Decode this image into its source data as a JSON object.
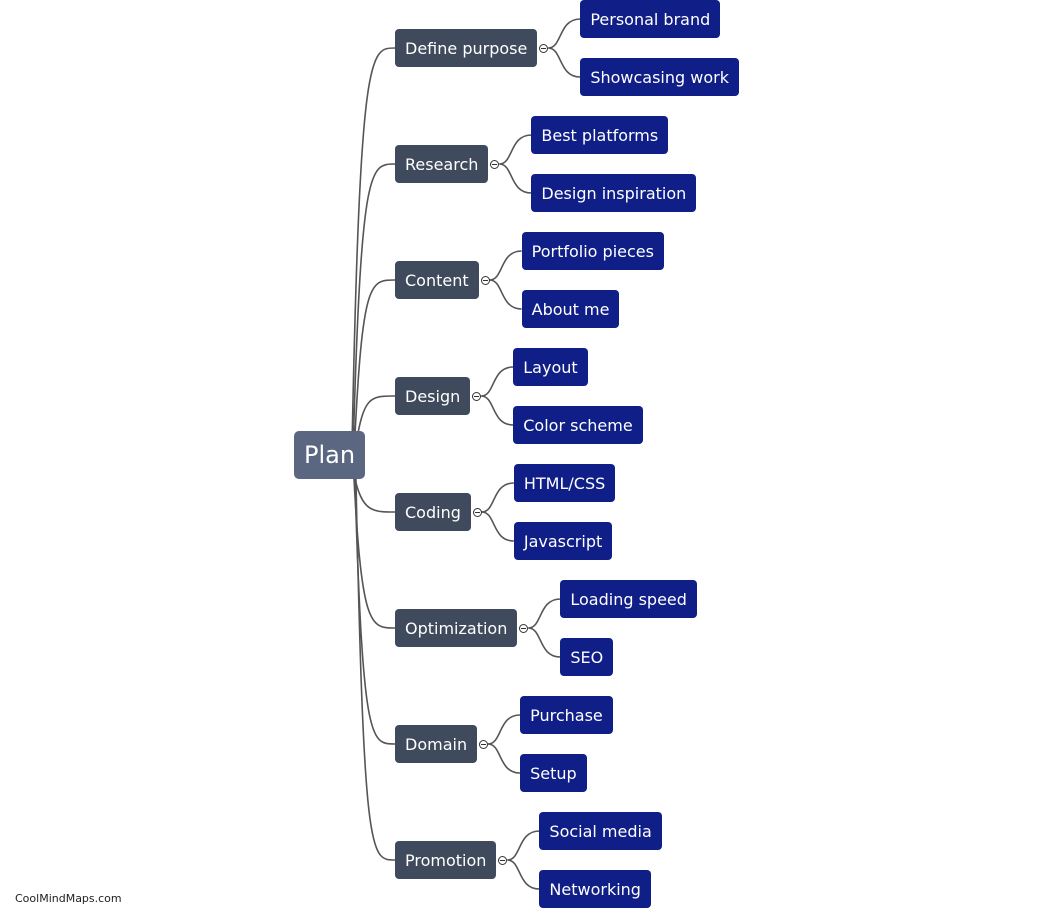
{
  "root": {
    "label": "Plan"
  },
  "branches": [
    {
      "label": "Define purpose",
      "children": [
        "Personal brand",
        "Showcasing work"
      ]
    },
    {
      "label": "Research",
      "children": [
        "Best platforms",
        "Design inspiration"
      ]
    },
    {
      "label": "Content",
      "children": [
        "Portfolio pieces",
        "About me"
      ]
    },
    {
      "label": "Design",
      "children": [
        "Layout",
        "Color scheme"
      ]
    },
    {
      "label": "Coding",
      "children": [
        "HTML/CSS",
        "Javascript"
      ]
    },
    {
      "label": "Optimization",
      "children": [
        "Loading speed",
        "SEO"
      ]
    },
    {
      "label": "Domain",
      "children": [
        "Purchase",
        "Setup"
      ]
    },
    {
      "label": "Promotion",
      "children": [
        "Social media",
        "Networking"
      ]
    }
  ],
  "colors": {
    "root": "#5b6680",
    "branch": "#3f4a5c",
    "leaf": "#101e87",
    "link": "#555555"
  },
  "watermark": "CoolMindMaps.com"
}
